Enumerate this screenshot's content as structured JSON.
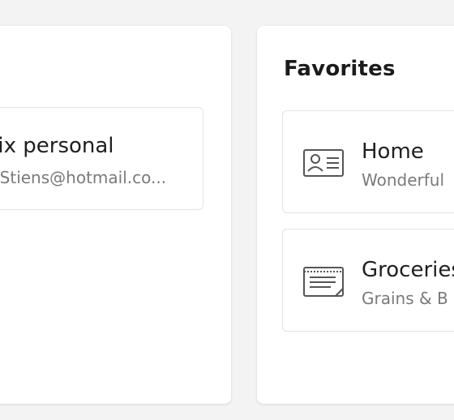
{
  "left_panel": {
    "card": {
      "title": "flix personal",
      "subtitle": "e.Stiens@hotmail.co..."
    }
  },
  "favorites": {
    "heading": "Favorites",
    "items": [
      {
        "icon": "contact-card-icon",
        "title": "Home",
        "subtitle": "Wonderful"
      },
      {
        "icon": "note-icon",
        "title": "Groceries",
        "subtitle": "Grains & B"
      }
    ]
  }
}
